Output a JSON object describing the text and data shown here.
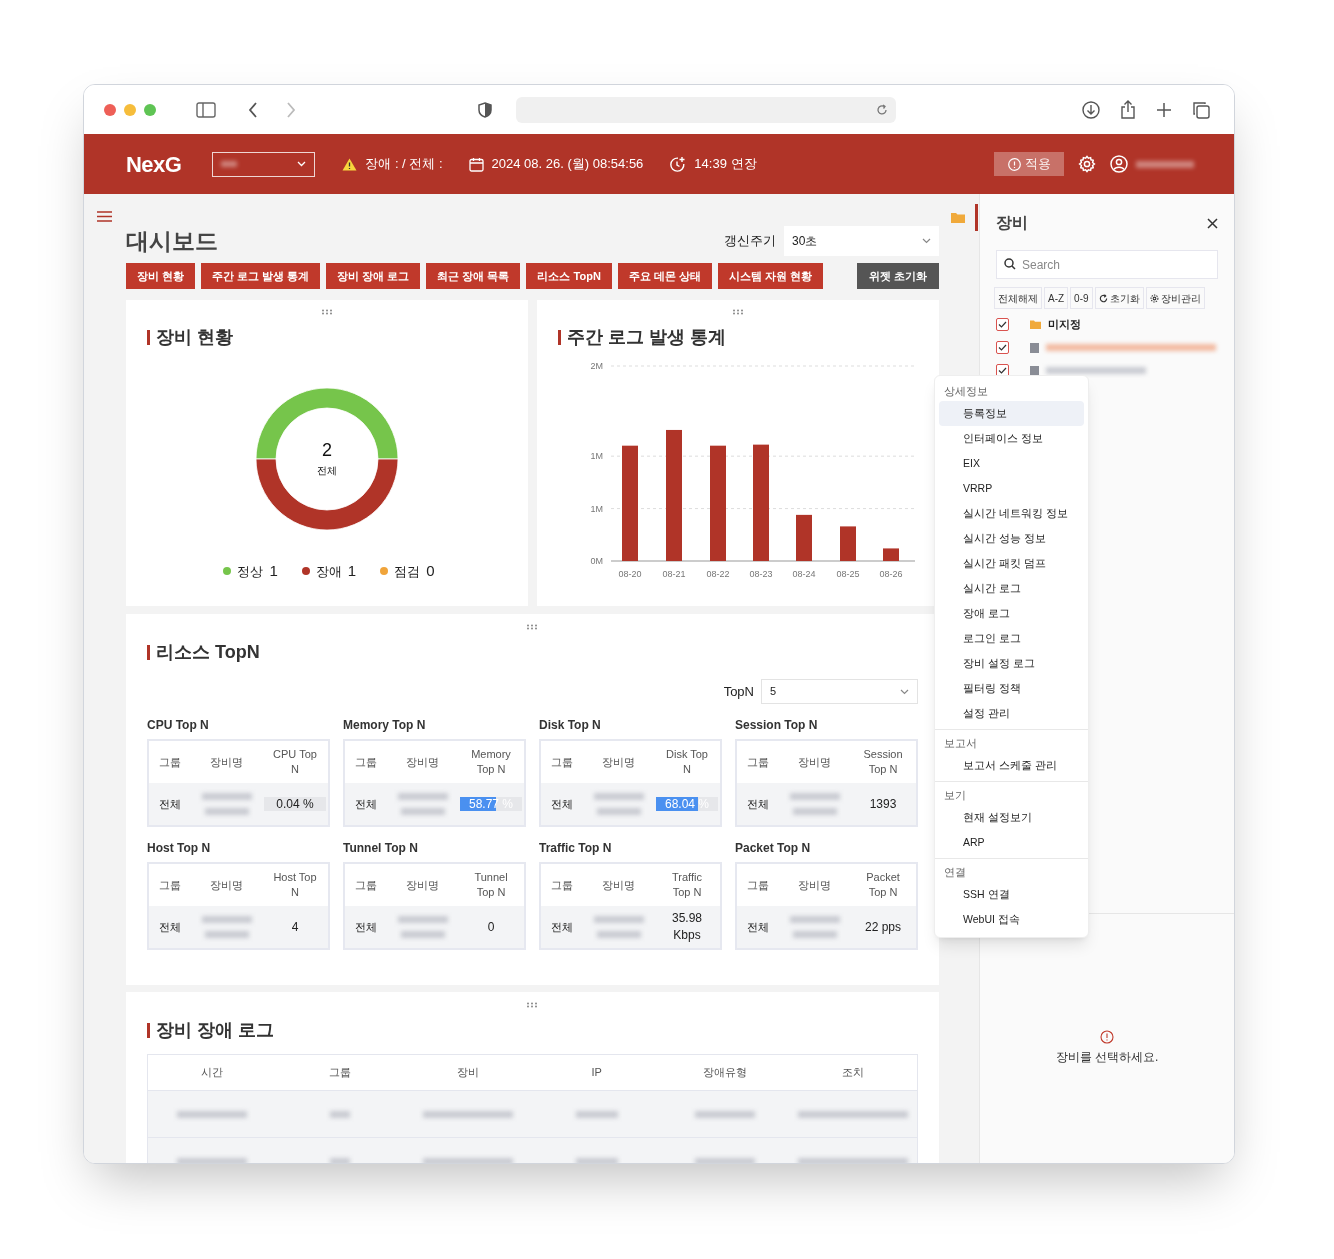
{
  "header": {
    "logo": "NexG",
    "alarm": "장애 : / 전체 :",
    "datetime": "2024 08. 26. (월) 08:54:56",
    "session": "14:39 연장",
    "apply_button": "적용"
  },
  "dashboard": {
    "title": "대시보드",
    "refresh_label": "갱신주기",
    "refresh_value": "30초",
    "widget_buttons": [
      "장비 현황",
      "주간 로그 발생 통계",
      "장비 장애 로그",
      "최근 장애 목록",
      "리소스 TopN",
      "주요 데몬 상태",
      "시스템 자원 현황"
    ],
    "reset_button": "위젯 초기화"
  },
  "device_status": {
    "title": "장비 현황",
    "total": "2",
    "total_label": "전체",
    "chart_data": {
      "type": "donut",
      "values": [
        50,
        50,
        0
      ]
    },
    "legend": [
      {
        "label": "정상",
        "count": "1",
        "color": "#76c54b"
      },
      {
        "label": "장애",
        "count": "1",
        "color": "#b03428"
      },
      {
        "label": "점검",
        "count": "0",
        "color": "#f0a43a"
      }
    ]
  },
  "weekly_log": {
    "title": "주간 로그 발생 통계",
    "chart_data": {
      "type": "bar",
      "categories": [
        "08-20",
        "08-21",
        "08-22",
        "08-23",
        "08-24",
        "08-25",
        "08-26"
      ],
      "series": [
        {
          "color": "#b03428",
          "values": [
            1.1,
            1.25,
            1.1,
            1.11,
            0.44,
            0.33,
            0.12
          ]
        }
      ],
      "ylim": [
        0,
        1.86
      ],
      "yticks": [
        {
          "value": 0,
          "label": "0M"
        },
        {
          "value": 0.5,
          "label": "1M"
        },
        {
          "value": 1,
          "label": "1M"
        },
        {
          "value": 1.86,
          "label": "2M"
        }
      ]
    }
  },
  "resource_topn": {
    "title": "리소스 TopN",
    "topn_label": "TopN",
    "topn_value": "5",
    "tables": [
      {
        "title": "CPU Top N",
        "columns": [
          "그룹",
          "장비명",
          "CPU Top N"
        ],
        "group": "전체",
        "value": "0.04 %",
        "kind": "meter",
        "level": 0.0004
      },
      {
        "title": "Memory Top N",
        "columns": [
          "그룹",
          "장비명",
          "Memory Top N"
        ],
        "group": "전체",
        "value": "58.77 %",
        "kind": "meter",
        "level": 0.5877
      },
      {
        "title": "Disk Top N",
        "columns": [
          "그룹",
          "장비명",
          "Disk Top N"
        ],
        "group": "전체",
        "value": "68.04 %",
        "kind": "meter",
        "level": 0.6804
      },
      {
        "title": "Session Top N",
        "columns": [
          "그룹",
          "장비명",
          "Session Top N"
        ],
        "group": "전체",
        "value": "1393",
        "kind": "plain"
      },
      {
        "title": "Host Top N",
        "columns": [
          "그룹",
          "장비명",
          "Host Top N"
        ],
        "group": "전체",
        "value": "4",
        "kind": "plain"
      },
      {
        "title": "Tunnel Top N",
        "columns": [
          "그룹",
          "장비명",
          "Tunnel Top N"
        ],
        "group": "전체",
        "value": "0",
        "kind": "plain"
      },
      {
        "title": "Traffic Top N",
        "columns": [
          "그룹",
          "장비명",
          "Traffic Top N"
        ],
        "group": "전체",
        "value": "35.98 Kbps",
        "kind": "plain"
      },
      {
        "title": "Packet Top N",
        "columns": [
          "그룹",
          "장비명",
          "Packet Top N"
        ],
        "group": "전체",
        "value": "22 pps",
        "kind": "plain"
      }
    ]
  },
  "fault_log": {
    "title": "장비 장애 로그",
    "columns": [
      "시간",
      "그룹",
      "장비",
      "IP",
      "장애유형",
      "조치"
    ]
  },
  "side_panel": {
    "title": "장비",
    "search_placeholder": "Search",
    "tools": [
      {
        "label": "전체해제",
        "kind": "text"
      },
      {
        "label": "A-Z",
        "kind": "text"
      },
      {
        "label": "0-9",
        "kind": "text"
      },
      {
        "label": "초기화",
        "kind": "reset"
      },
      {
        "label": "장비관리",
        "kind": "settings"
      }
    ],
    "tree": [
      {
        "kind": "folder",
        "label": "미지정",
        "checked": true
      },
      {
        "kind": "device",
        "checked": true
      },
      {
        "kind": "device",
        "checked": true
      }
    ],
    "empty_message": "장비를 선택하세요."
  },
  "context_menu": {
    "sections": [
      {
        "title": "상세정보",
        "items": [
          {
            "label": "등록정보",
            "selected": true
          },
          {
            "label": "인터페이스 정보",
            "selected": false
          },
          {
            "label": "EIX",
            "selected": false
          },
          {
            "label": "VRRP",
            "selected": false
          },
          {
            "label": "실시간 네트워킹 정보",
            "selected": false
          },
          {
            "label": "실시간 성능 정보",
            "selected": false
          },
          {
            "label": "실시간 패킷 덤프",
            "selected": false
          },
          {
            "label": "실시간 로그",
            "selected": false
          },
          {
            "label": "장애 로그",
            "selected": false
          },
          {
            "label": "로그인 로그",
            "selected": false
          },
          {
            "label": "장비 설정 로그",
            "selected": false
          },
          {
            "label": "필터링 정책",
            "selected": false
          },
          {
            "label": "설정 관리",
            "selected": false
          }
        ]
      },
      {
        "title": "보고서",
        "items": [
          {
            "label": "보고서 스케줄 관리",
            "selected": false
          }
        ]
      },
      {
        "title": "보기",
        "items": [
          {
            "label": "현재 설정보기",
            "selected": false
          },
          {
            "label": "ARP",
            "selected": false
          }
        ]
      },
      {
        "title": "연결",
        "items": [
          {
            "label": "SSH 연결",
            "selected": false
          },
          {
            "label": "WebUI 접속",
            "selected": false
          }
        ]
      }
    ]
  }
}
